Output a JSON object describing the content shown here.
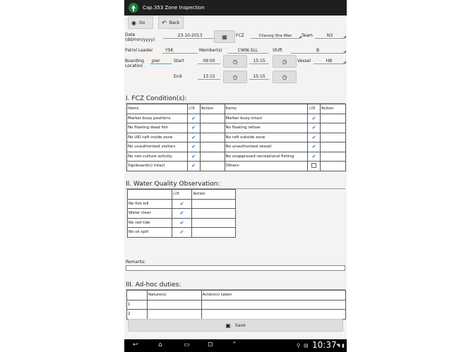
{
  "app": {
    "title": "Cap.353 Zone Inspection"
  },
  "toolbar": {
    "go_label": "Go",
    "back_label": "Back"
  },
  "form": {
    "date_label": "Date\n(dd/mm/yyyy)",
    "date_value": "23-10-2013",
    "fcz_label": "FCZ",
    "fcz_value": "Cheung Sha Wan",
    "team_label": "Team",
    "team_value": "N3",
    "patrol_leader_label": "Patrol Leader",
    "patrol_leader_value": "YSK",
    "members_label": "Member(s)",
    "members_value": "CWW,SLL",
    "shift_label": "Shift",
    "shift_value": "B",
    "boarding_label": "Boarding\nLocation",
    "boarding_value": "pier",
    "start_label": "Start",
    "start_time_1": "09:00",
    "start_time_2": "15:15",
    "end_label": "End",
    "end_time_1": "13:15",
    "end_time_2": "15:15",
    "vessel_label": "Vessel",
    "vessel_value": "HB"
  },
  "section1": {
    "title": "I. FCZ Condition(s):",
    "headers": [
      "Items",
      "√/X",
      "Action",
      "Items",
      "√/X",
      "Action"
    ],
    "rows": [
      {
        "left": "Marker buoy positions",
        "right": "Marker buoy intact"
      },
      {
        "left": "No floating dead fish",
        "right": "No floating refuse"
      },
      {
        "left": "No UID raft inside zone",
        "right": "No raft outside zone"
      },
      {
        "left": "No unauthorized visitors",
        "right": "No unauthorized vessel"
      },
      {
        "left": "No non-culture activity",
        "right": "No unapproved recreational fishing"
      },
      {
        "left": "Signboard(s) intact",
        "right": "Others:"
      }
    ]
  },
  "section2": {
    "title": "II. Water Quality Observation:",
    "headers": [
      "",
      "√/X",
      "Action"
    ],
    "rows": [
      "No fish kill",
      "Water clear",
      "No red tide",
      "No oil spill"
    ]
  },
  "remarks": {
    "label": "Remarks:"
  },
  "section3": {
    "title": "III. Ad-hoc duties:",
    "headers": [
      "",
      "Nature(s)",
      "Action(s) taken"
    ],
    "rows": [
      "1",
      "2"
    ]
  },
  "save": {
    "label": "Save"
  },
  "statusbar": {
    "time": "10:37"
  }
}
